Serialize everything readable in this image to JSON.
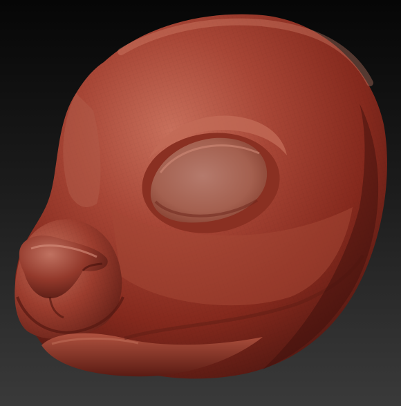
{
  "scene": {
    "subject": "sculpted-animal-head",
    "material_color": "#9a3a2c",
    "highlight_color": "#c86a55",
    "shadow_color": "#4a1610",
    "background_top": "#060606",
    "background_bottom": "#3a3a3a"
  }
}
